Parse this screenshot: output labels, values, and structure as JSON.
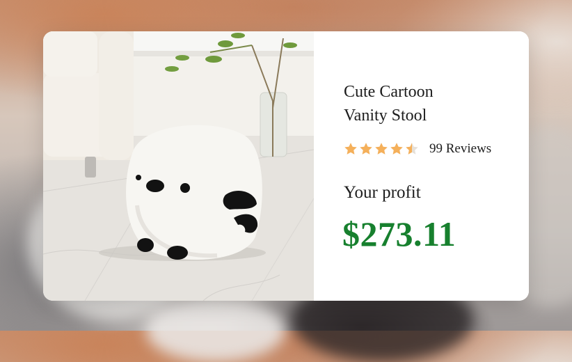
{
  "product": {
    "title_line1": "Cute Cartoon",
    "title_line2": "Vanity Stool",
    "rating": 4.5,
    "rating_max": 5,
    "reviews": "99 Reviews",
    "image_subject": "cartoon-panda-stool-photo"
  },
  "profit": {
    "label": "Your profit",
    "value": "$273.11"
  },
  "colors": {
    "star": "#f5b05a",
    "star_empty": "#e6e0d8",
    "profit": "#17802e",
    "text": "#1d1d1d"
  }
}
